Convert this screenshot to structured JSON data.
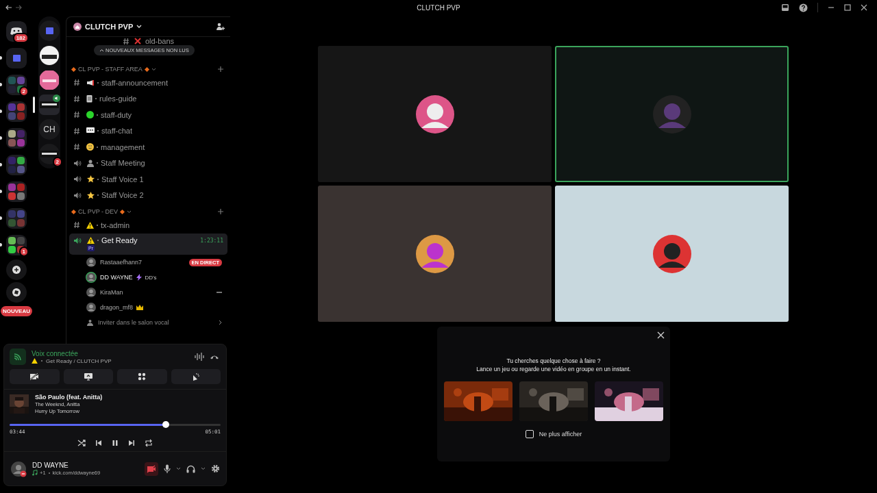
{
  "window": {
    "title": "CLUTCH PVP"
  },
  "rail": [
    {
      "kind": "dm",
      "badge": "182"
    },
    {
      "kind": "folder"
    },
    {
      "kind": "group",
      "badge": "2"
    },
    {
      "kind": "group"
    },
    {
      "kind": "group"
    },
    {
      "kind": "group"
    },
    {
      "kind": "group"
    },
    {
      "kind": "group"
    },
    {
      "kind": "group",
      "badge": "1"
    },
    {
      "kind": "add"
    },
    {
      "kind": "discover"
    }
  ],
  "new_badge": "NOUVEAU",
  "folder_items": [
    {
      "kind": "folder",
      "selected": false
    },
    {
      "kind": "server",
      "selected": false
    },
    {
      "kind": "server",
      "selected": false
    },
    {
      "kind": "server",
      "selected": true,
      "voice": true
    },
    {
      "kind": "initials",
      "label": "CH",
      "selected": false
    },
    {
      "kind": "server",
      "selected": false,
      "badge": "2"
    }
  ],
  "server": {
    "name": "CLUTCH PVP"
  },
  "unread_pill": "NOUVEAUX MESSAGES NON LUS",
  "top_channel": {
    "kind": "text",
    "name": "old-bans"
  },
  "categories": [
    {
      "name": "CL PVP - STAFF AREA",
      "channels": [
        {
          "kind": "text",
          "name": "staff-announcement",
          "selected": false
        },
        {
          "kind": "text",
          "name": "rules-guide",
          "selected": false
        },
        {
          "kind": "text",
          "name": "staff-duty",
          "selected": false
        },
        {
          "kind": "text",
          "name": "staff-chat",
          "selected": false
        },
        {
          "kind": "text",
          "name": "management",
          "selected": false
        },
        {
          "kind": "voice",
          "name": "Staff Meeting",
          "selected": false
        },
        {
          "kind": "voice",
          "name": "Staff Voice 1",
          "selected": false
        },
        {
          "kind": "voice",
          "name": "Staff Voice 2",
          "selected": false
        }
      ]
    },
    {
      "name": "CL PVP - DEV",
      "channels": [
        {
          "kind": "text",
          "name": "tx-admin",
          "selected": false
        },
        {
          "kind": "voice",
          "name": "Get Ready",
          "selected": true,
          "timer": "1:23:11",
          "app_tag": "Pr",
          "members": [
            {
              "name": "Rastaaefhann7",
              "live": "EN DIRECT",
              "speaking": false
            },
            {
              "name": "DD WAYNE",
              "tag": "DD's",
              "speaking": true
            },
            {
              "name": "KiraMan",
              "speaking": false,
              "more": true
            },
            {
              "name": "dragon_mf8",
              "speaking": false,
              "crown": true
            }
          ],
          "invite": "Inviter dans le salon vocal"
        }
      ]
    }
  ],
  "voice_panel": {
    "status": "Voix connectée",
    "location": "Get Ready / CLUTCH PVP"
  },
  "music": {
    "title": "São Paulo (feat. Anitta)",
    "artist": "The Weeknd, Anitta",
    "album": "Hurry Up Tomorrow",
    "elapsed": "03:44",
    "total": "05:01",
    "level": 0.74
  },
  "user": {
    "name": "DD WAYNE",
    "activity": "+1",
    "link": "kick.com/ddwayne69",
    "camera_off": true
  },
  "tiles": [
    {
      "color": "#161616",
      "speaking": false
    },
    {
      "color": "#0f1614",
      "speaking": true
    },
    {
      "color": "#3a3331",
      "speaking": false
    },
    {
      "color": "#c8d8de",
      "speaking": false
    }
  ],
  "activity_popup": {
    "title": "Tu cherches quelque chose à faire ?",
    "subtitle": "Lance un jeu ou regarde une vidéo en groupe en un instant.",
    "checkbox": {
      "label": "Ne plus afficher",
      "checked": false
    }
  }
}
